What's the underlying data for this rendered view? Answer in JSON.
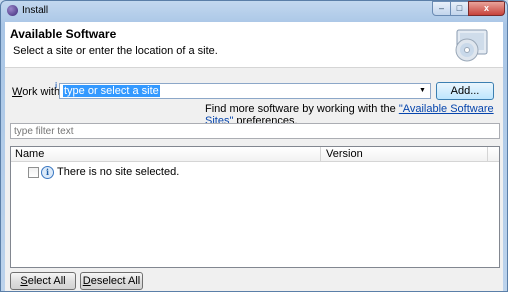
{
  "window": {
    "title": "Install",
    "controls": {
      "minimize_glyph": "–",
      "maximize_glyph": "□",
      "close_glyph": "x"
    }
  },
  "header": {
    "title": "Available Software",
    "description": "Select a site or enter the location of a site."
  },
  "work_with": {
    "label_mnemonic": "W",
    "label_rest": "ork with:",
    "combo_value": "type or select a site",
    "add_button": "Add..."
  },
  "more_software": {
    "prefix": "Find more software by working with the ",
    "link_text": "\"Available Software Sites\"",
    "suffix": " preferences."
  },
  "filter": {
    "placeholder": "type filter text"
  },
  "table": {
    "columns": [
      "Name",
      "Version"
    ],
    "rows": [
      {
        "text": "There is no site selected.",
        "checked": false
      }
    ]
  },
  "footer": {
    "select_all_mnemonic": "S",
    "select_all_rest": "elect All",
    "deselect_all_mnemonic": "D",
    "deselect_all_rest": "eselect All"
  },
  "icons": {
    "app": "eclipse-icon",
    "banner": "software-cd-icon",
    "info": "info-icon",
    "dropdown": "chevron-down-icon"
  },
  "colors": {
    "selection": "#3399ff",
    "link": "#0645ad"
  }
}
